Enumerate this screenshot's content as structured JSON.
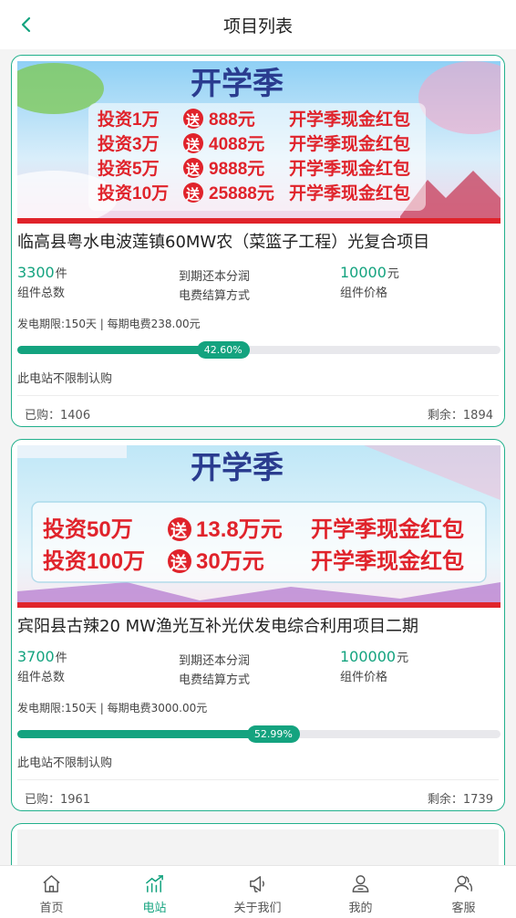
{
  "header": {
    "title": "项目列表"
  },
  "projects": [
    {
      "banner": {
        "heading": "开学季",
        "lines": [
          {
            "invest": "投资1万",
            "gift": "送",
            "amount": "888元",
            "tag": "开学季现金红包"
          },
          {
            "invest": "投资3万",
            "gift": "送",
            "amount": "4088元",
            "tag": "开学季现金红包"
          },
          {
            "invest": "投资5万",
            "gift": "送",
            "amount": "9888元",
            "tag": "开学季现金红包"
          },
          {
            "invest": "投资10万",
            "gift": "送",
            "amount": "25888元",
            "tag": "开学季现金红包"
          }
        ]
      },
      "name": "临高县粤水电波莲镇60MW农（菜篮子工程）光复合项目",
      "components_total": {
        "value": "3300",
        "unit": "件",
        "label": "组件总数"
      },
      "settlement": {
        "value": "到期还本分润",
        "label": "电费结算方式"
      },
      "price": {
        "value": "10000",
        "unit": "元",
        "label": "组件价格"
      },
      "period": "发电期限:150天 | 每期电费238.00元",
      "progress": 42.6,
      "progress_label": "42.60%",
      "limit_text": "此电站不限制认购",
      "bought": "已购：1406",
      "remaining": "剩余：1894"
    },
    {
      "banner": {
        "heading": "开学季",
        "lines": [
          {
            "invest": "投资50万",
            "gift": "送",
            "amount": "13.8万元",
            "tag": "开学季现金红包"
          },
          {
            "invest": "投资100万",
            "gift": "送",
            "amount": "30万元",
            "tag": "开学季现金红包"
          }
        ]
      },
      "name": "宾阳县古辣20 MW渔光互补光伏发电综合利用项目二期",
      "components_total": {
        "value": "3700",
        "unit": "件",
        "label": "组件总数"
      },
      "settlement": {
        "value": "到期还本分润",
        "label": "电费结算方式"
      },
      "price": {
        "value": "100000",
        "unit": "元",
        "label": "组件价格"
      },
      "period": "发电期限:150天 | 每期电费3000.00元",
      "progress": 52.99,
      "progress_label": "52.99%",
      "limit_text": "此电站不限制认购",
      "bought": "已购：1961",
      "remaining": "剩余：1739"
    }
  ],
  "tabs": [
    {
      "label": "首页",
      "icon": "home-icon",
      "active": false
    },
    {
      "label": "电站",
      "icon": "chart-icon",
      "active": true
    },
    {
      "label": "关于我们",
      "icon": "megaphone-icon",
      "active": false
    },
    {
      "label": "我的",
      "icon": "user-icon",
      "active": false
    },
    {
      "label": "客服",
      "icon": "service-icon",
      "active": false
    }
  ],
  "colors": {
    "accent": "#14a37f",
    "border": "#22b08c",
    "banner_red": "#e0232b",
    "banner_blue": "#2a3c8f"
  }
}
